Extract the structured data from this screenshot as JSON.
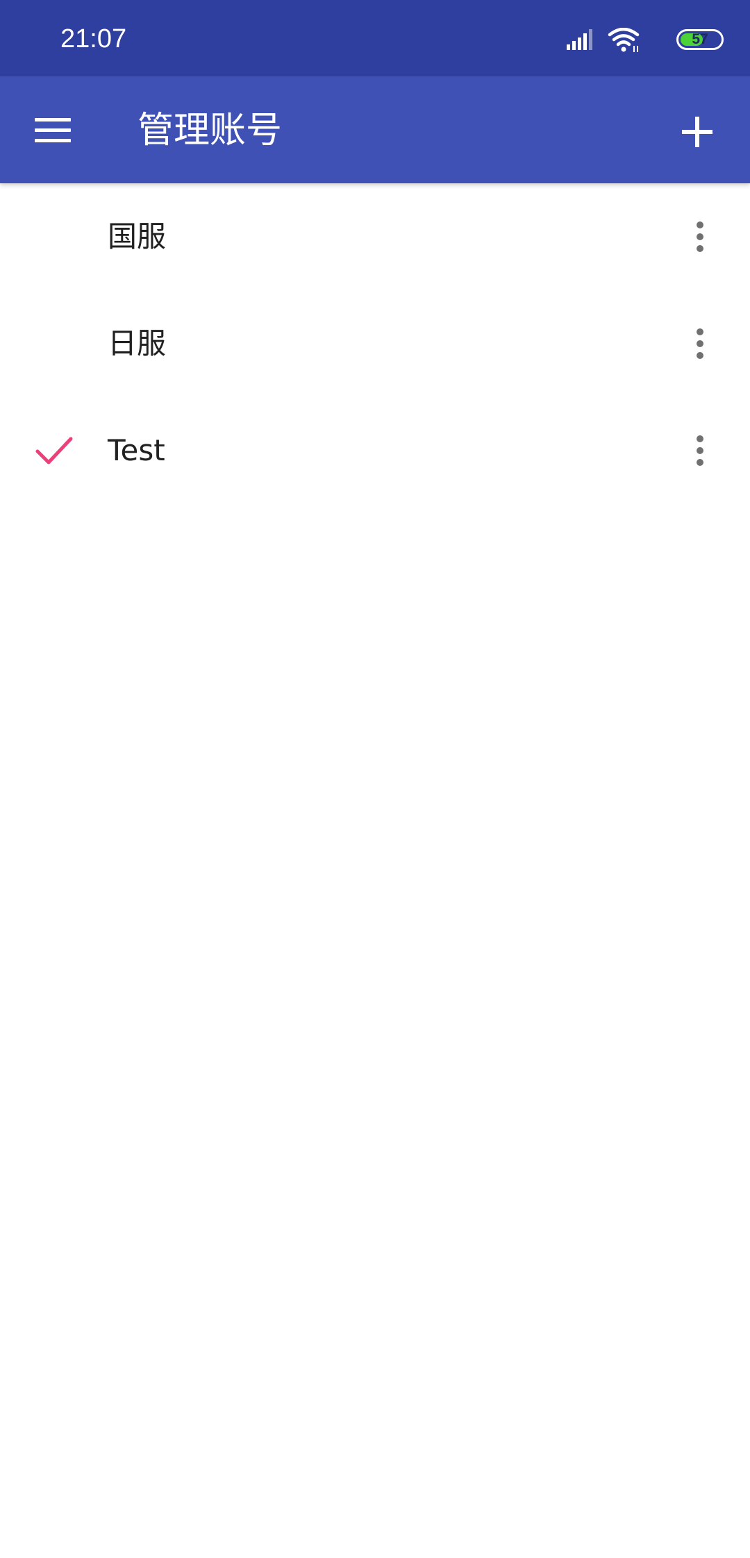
{
  "status_bar": {
    "time": "21:07",
    "battery_level": "57",
    "battery_fill_fraction": 0.57,
    "signal_icon": "cellular-signal-icon",
    "wifi_icon": "wifi-icon",
    "battery_icon": "battery-icon"
  },
  "app_bar": {
    "title": "管理账号",
    "menu_icon": "hamburger-menu-icon",
    "add_icon": "plus-icon",
    "background_color": "#3f51b5",
    "status_bar_color": "#2f3f9f"
  },
  "accounts": [
    {
      "name": "国服",
      "selected": false,
      "more_icon": "more-vertical-icon"
    },
    {
      "name": "日服",
      "selected": false,
      "more_icon": "more-vertical-icon"
    },
    {
      "name": "Test",
      "selected": true,
      "check_icon": "check-icon",
      "more_icon": "more-vertical-icon"
    }
  ],
  "colors": {
    "accent": "#ec407a",
    "text_primary": "#212121",
    "icon_gray": "#707070"
  }
}
